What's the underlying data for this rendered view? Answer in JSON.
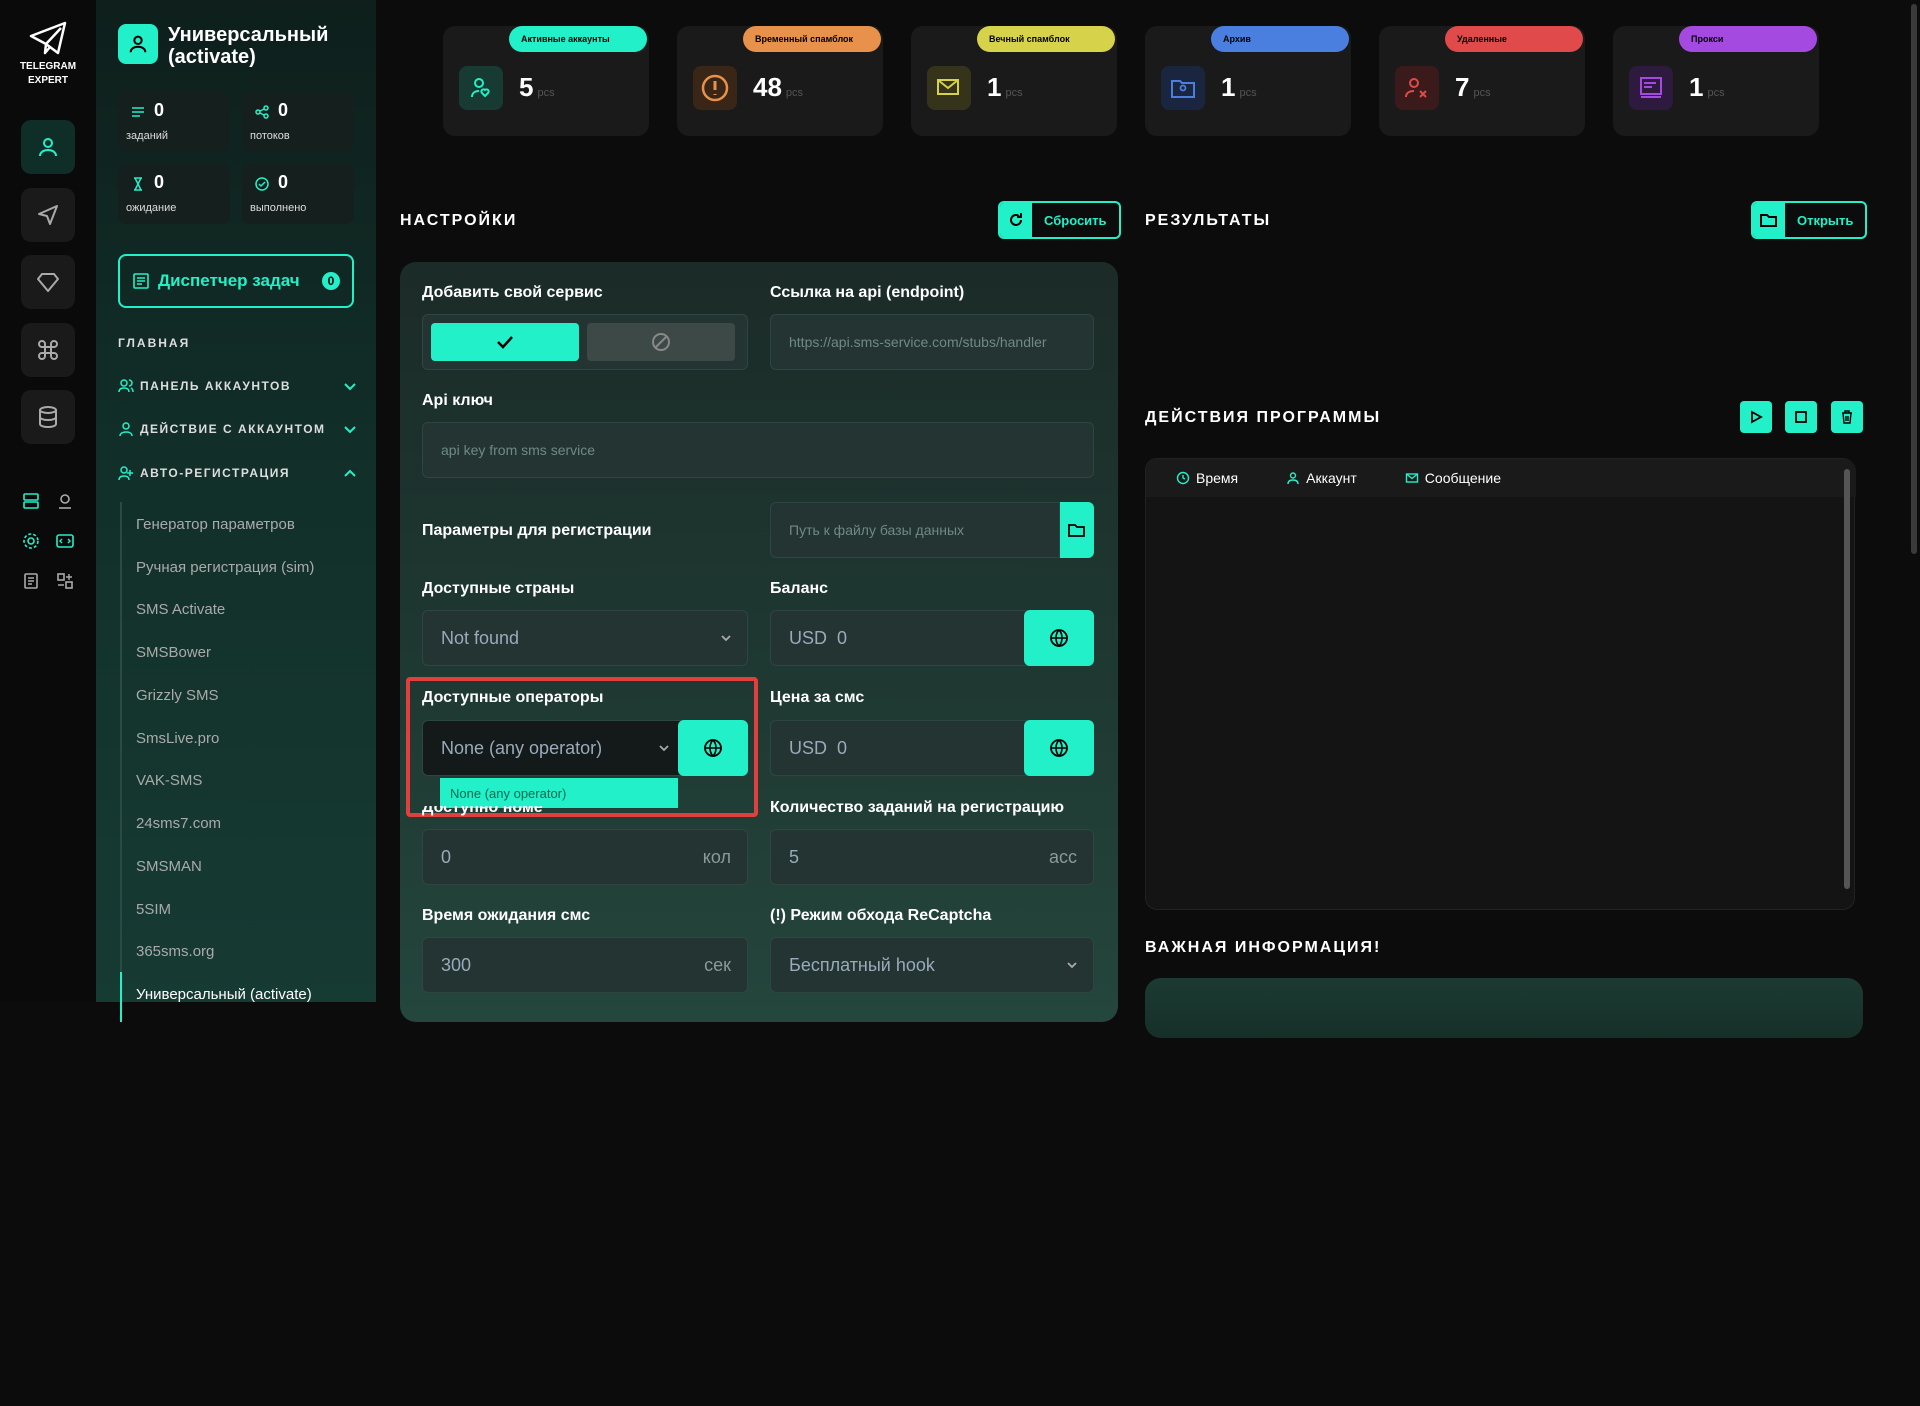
{
  "app": {
    "logo_line1": "TELEGRAM",
    "logo_line2": "EXPERT"
  },
  "profile": {
    "name": "Универсальный (activate)"
  },
  "stats": [
    {
      "value": "0",
      "label": "заданий"
    },
    {
      "value": "0",
      "label": "потоков"
    },
    {
      "value": "0",
      "label": "ожидание"
    },
    {
      "value": "0",
      "label": "выполнено"
    }
  ],
  "dispatcher": {
    "label": "Диспетчер задач",
    "badge": "0"
  },
  "nav": {
    "section": "ГЛАВНАЯ",
    "menu": [
      "ПАНЕЛЬ АККАУНТОВ",
      "ДЕЙСТВИЕ С АККАУНТОМ",
      "АВТО-РЕГИСТРАЦИЯ"
    ],
    "sub": [
      "Генератор параметров",
      "Ручная регистрация (sim)",
      "SMS Activate",
      "SMSBower",
      "Grizzly SMS",
      "SmsLive.pro",
      "VAK-SMS",
      "24sms7.com",
      "SMSMAN",
      "5SIM",
      "365sms.org",
      "Универсальный (activate)"
    ]
  },
  "cards": [
    {
      "tag": "Активные аккаунты",
      "value": "5",
      "unit": "pcs",
      "color": "#22f0c8",
      "icon": "user-heart-icon"
    },
    {
      "tag": "Временный спамблок",
      "value": "48",
      "unit": "pcs",
      "color": "#e8914a",
      "icon": "warning-icon"
    },
    {
      "tag": "Вечный спамблок",
      "value": "1",
      "unit": "pcs",
      "color": "#d6d34a",
      "icon": "mail-block-icon"
    },
    {
      "tag": "Архив",
      "value": "1",
      "unit": "pcs",
      "color": "#4a7fe0",
      "icon": "archive-folder-icon"
    },
    {
      "tag": "Удаленные",
      "value": "7",
      "unit": "pcs",
      "color": "#e04a4a",
      "icon": "user-x-icon"
    },
    {
      "tag": "Прокси",
      "value": "1",
      "unit": "pcs",
      "color": "#a54ae0",
      "icon": "proxy-icon"
    }
  ],
  "settings": {
    "title": "НАСТРОЙКИ",
    "reset_label": "Сбросить",
    "add_service_label": "Добавить свой сервис",
    "endpoint_label": "Ссылка на api (endpoint)",
    "endpoint_placeholder": "https://api.sms-service.com/stubs/handler",
    "api_key_label": "Api ключ",
    "api_key_placeholder": "api key from sms service",
    "reg_params_label": "Параметры для регистрации",
    "db_path_placeholder": "Путь к файлу базы данных",
    "countries_label": "Доступные страны",
    "countries_value": "Not found",
    "balance_label": "Баланс",
    "balance_currency": "USD",
    "balance_value": "0",
    "operators_label": "Доступные операторы",
    "operators_value": "None (any operator)",
    "operators_option": "None (any operator)",
    "price_label": "Цена за смс",
    "price_currency": "USD",
    "price_value": "0",
    "numbers_label": "Доступно номеров",
    "numbers_value": "0",
    "numbers_unit": "кол",
    "tasks_label": "Количество заданий на регистрацию",
    "tasks_value": "5",
    "tasks_unit": "acc",
    "wait_label": "Время ожидания смс",
    "wait_value": "300",
    "wait_unit": "сек",
    "recaptcha_label": "(!) Режим обхода ReCaptcha",
    "recaptcha_value": "Бесплатный hook"
  },
  "results": {
    "title": "РЕЗУЛЬТАТЫ",
    "open_label": "Открыть"
  },
  "actions": {
    "title": "ДЕЙСТВИЯ ПРОГРАММЫ",
    "cols": [
      "Время",
      "Аккаунт",
      "Сообщение"
    ]
  },
  "info": {
    "title": "ВАЖНАЯ ИНФОРМАЦИЯ!"
  },
  "colors": {
    "accent": "#22f0c8",
    "highlight": "#e13e3e"
  }
}
